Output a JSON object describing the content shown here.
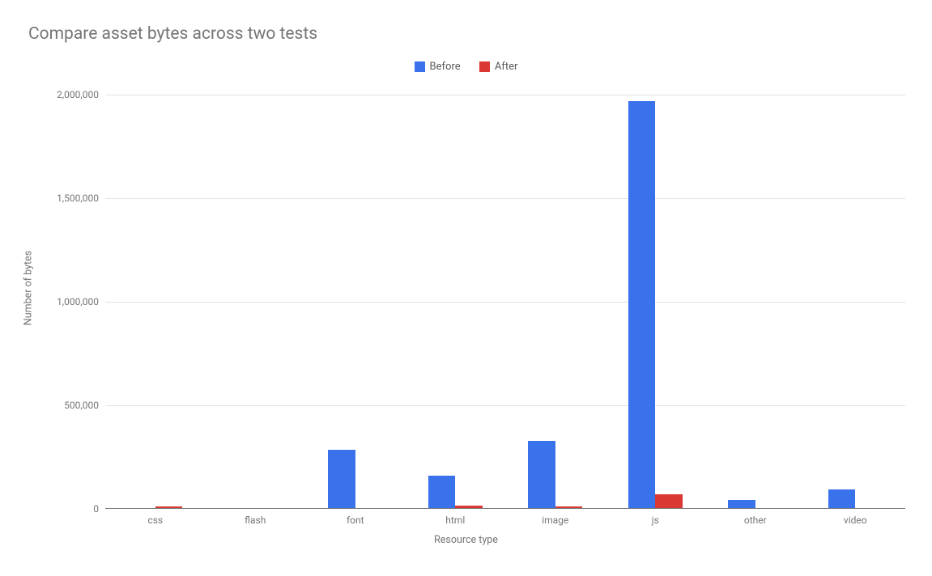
{
  "title": "Compare asset bytes across two tests",
  "xlabel": "Resource type",
  "ylabel": "Number of bytes",
  "legend": {
    "before": "Before",
    "after": "After"
  },
  "colors": {
    "before": "#3a72ec",
    "after": "#da3833"
  },
  "y_ticks": [
    "0",
    "500,000",
    "1,000,000",
    "1,500,000",
    "2,000,000"
  ],
  "chart_data": {
    "type": "bar",
    "title": "Compare asset bytes across two tests",
    "xlabel": "Resource type",
    "ylabel": "Number of bytes",
    "ylim": [
      0,
      2000000
    ],
    "categories": [
      "css",
      "flash",
      "font",
      "html",
      "image",
      "js",
      "other",
      "video"
    ],
    "series": [
      {
        "name": "Before",
        "values": [
          0,
          0,
          280000,
          155000,
          325000,
          1965000,
          40000,
          90000
        ]
      },
      {
        "name": "After",
        "values": [
          8000,
          0,
          0,
          12000,
          8000,
          68000,
          0,
          0
        ]
      }
    ]
  }
}
